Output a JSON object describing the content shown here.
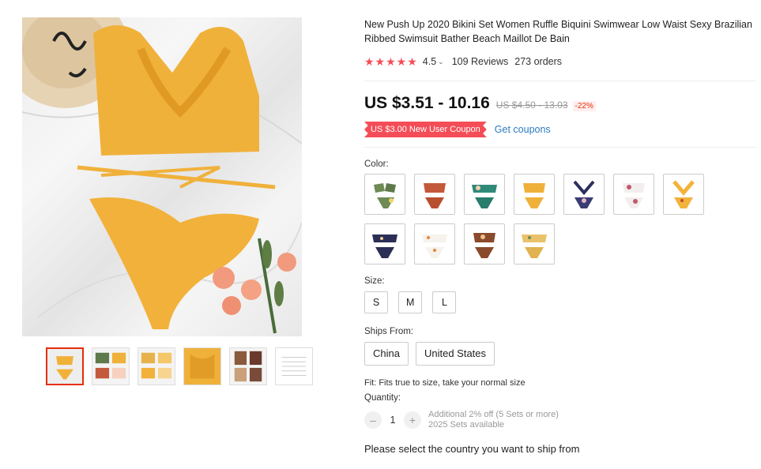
{
  "product": {
    "title": "New Push Up 2020 Bikini Set Women Ruffle Biquini Swimwear Low Waist Sexy Brazilian Ribbed Swimsuit Bather Beach Maillot De Bain",
    "rating_stars": "★★★★★",
    "rating_value": "4.5",
    "rating_caret": "⌄",
    "reviews": "109 Reviews",
    "orders": "273 orders",
    "price": "US $3.51 - 10.16",
    "old_price": "US $4.50 - 13.03",
    "discount": "-22%",
    "coupon": "US $3.00 New User Coupon",
    "get_coupons": "Get coupons"
  },
  "options": {
    "color_label": "Color:",
    "color_swatches": [
      "olive-floral",
      "rust-ruffle",
      "teal-print",
      "mustard-ruffle",
      "navy-floral",
      "white-floral",
      "yellow-floral",
      "navy-print",
      "white-print",
      "brown-floral",
      "mustard-floral"
    ],
    "size_label": "Size:",
    "sizes": [
      "S",
      "M",
      "L"
    ],
    "ships_label": "Ships From:",
    "ships_from": [
      "China",
      "United States"
    ],
    "fit": "Fit: Fits true to size, take your normal size",
    "quantity_label": "Quantity:",
    "qty_minus": "–",
    "qty_plus": "+",
    "quantity": "1",
    "qty_note_1": "Additional 2% off (5 Sets or more)",
    "qty_note_2": "2025 Sets available",
    "ship_message": "Please select the country you want to ship from"
  },
  "colors": {
    "accent": "#f44d58",
    "link": "#2c7bbf",
    "price_cut": "#e62e04",
    "mustard": "#f0b13b"
  }
}
